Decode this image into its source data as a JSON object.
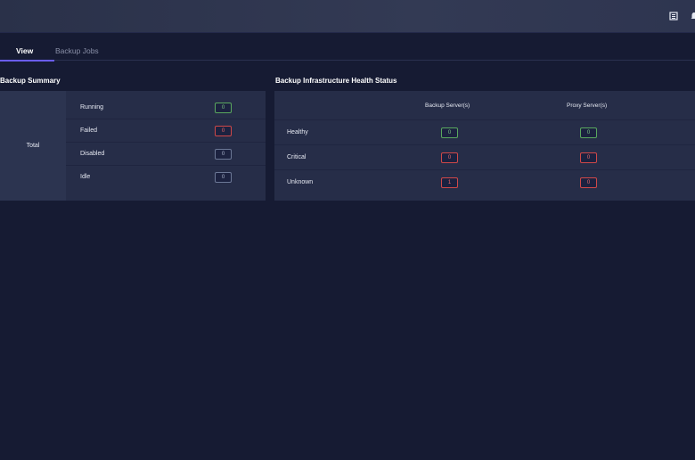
{
  "topbar": {
    "icons": [
      "book-icon",
      "bell-icon"
    ]
  },
  "tabs": [
    {
      "label": "View",
      "active": true
    },
    {
      "label": "Backup Jobs",
      "active": false
    }
  ],
  "backup_summary": {
    "title": "Backup Summary",
    "group_label": "Total",
    "rows": [
      {
        "label": "Running",
        "value": "0",
        "status": "green"
      },
      {
        "label": "Failed",
        "value": "0",
        "status": "red"
      },
      {
        "label": "Disabled",
        "value": "0",
        "status": "gray"
      },
      {
        "label": "Idle",
        "value": "0",
        "status": "gray"
      }
    ]
  },
  "health": {
    "title": "Backup Infrastructure Health Status",
    "columns": [
      "Backup Server(s)",
      "Proxy Server(s)"
    ],
    "rows": [
      {
        "label": "Healthy",
        "values": [
          "0",
          "0"
        ],
        "status": "green"
      },
      {
        "label": "Critical",
        "values": [
          "0",
          "0"
        ],
        "status": "red"
      },
      {
        "label": "Unknown",
        "values": [
          "1",
          "0"
        ],
        "status": "red"
      }
    ]
  },
  "colors": {
    "accent": "#6a5cf0",
    "green": "#5aa85e",
    "red": "#d04848",
    "gray": "#6c7896"
  }
}
